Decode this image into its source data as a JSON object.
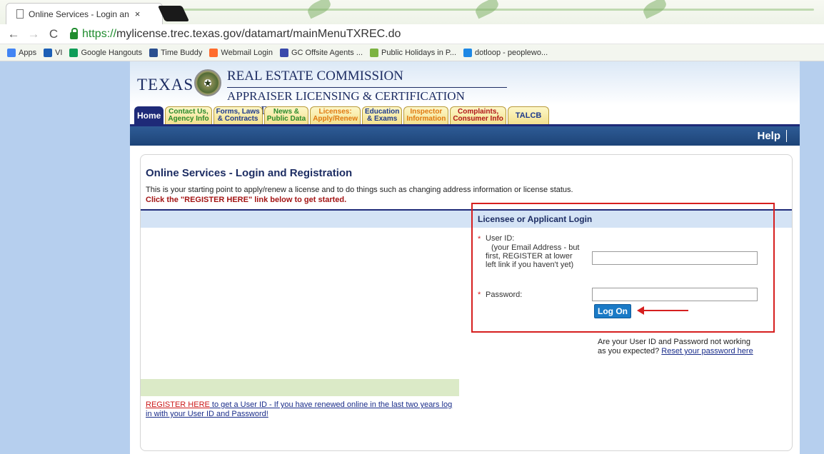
{
  "browser": {
    "tab_title": "Online Services - Login an",
    "tab_close": "×",
    "url_scheme": "https://",
    "url_rest": "mylicense.trec.texas.gov/datamart/mainMenuTXREC.do",
    "bookmarks": [
      {
        "label": "Apps",
        "icon": "apps-grid-icon",
        "color": "#4285f4"
      },
      {
        "label": "VI",
        "icon": "video-icon",
        "color": "#1c5fb6"
      },
      {
        "label": "Google Hangouts",
        "icon": "hangouts-icon",
        "color": "#0f9d58"
      },
      {
        "label": "Time Buddy",
        "icon": "time-buddy-icon",
        "color": "#2a4f8f"
      },
      {
        "label": "Webmail Login",
        "icon": "cpanel-icon",
        "color": "#ff6c2c"
      },
      {
        "label": "GC Offsite Agents ...",
        "icon": "sheet-icon",
        "color": "#3949ab"
      },
      {
        "label": "Public Holidays in P...",
        "icon": "calendar-icon",
        "color": "#7cb342"
      },
      {
        "label": "dotloop - peoplewo...",
        "icon": "dotloop-icon",
        "color": "#1e88e5"
      }
    ]
  },
  "header": {
    "texas": "TEXAS",
    "commission": "REAL ESTATE COMMISSION",
    "board": "APPRAISER LICENSING & CERTIFICATION BOARD",
    "help": "Help"
  },
  "nav_tabs": [
    {
      "l1": "Home",
      "l2": ""
    },
    {
      "l1": "Contact Us,",
      "l2": "Agency Info"
    },
    {
      "l1": "Forms, Laws",
      "l2": "& Contracts"
    },
    {
      "l1": "News &",
      "l2": "Public Data"
    },
    {
      "l1": "Licenses:",
      "l2": "Apply/Renew"
    },
    {
      "l1": "Education",
      "l2": "& Exams"
    },
    {
      "l1": "Inspector",
      "l2": "Information"
    },
    {
      "l1": "Complaints,",
      "l2": "Consumer Info"
    },
    {
      "l1": "TALCB",
      "l2": ""
    }
  ],
  "main": {
    "title": "Online Services - Login and Registration",
    "intro": "This is your starting point to apply/renew a license and to do things such as changing address information or license status.",
    "cta": "Click the \"REGISTER HERE\" link below to get started.",
    "register_link": "REGISTER HERE",
    "register_rest": " to get a User ID - If you have renewed online in the last two years log in with your User ID and Password!"
  },
  "login": {
    "heading": "Licensee or Applicant Login",
    "required_mark": "*",
    "userid_label": "User ID:",
    "userid_hint": "(your Email Address - but first, REGISTER at lower left link if you haven't yet)",
    "userid_value": "",
    "password_label": "Password:",
    "password_value": "",
    "logon": "Log On",
    "reset_text": "Are your User ID and Password not working as you expected? ",
    "reset_link": "Reset your password here"
  }
}
